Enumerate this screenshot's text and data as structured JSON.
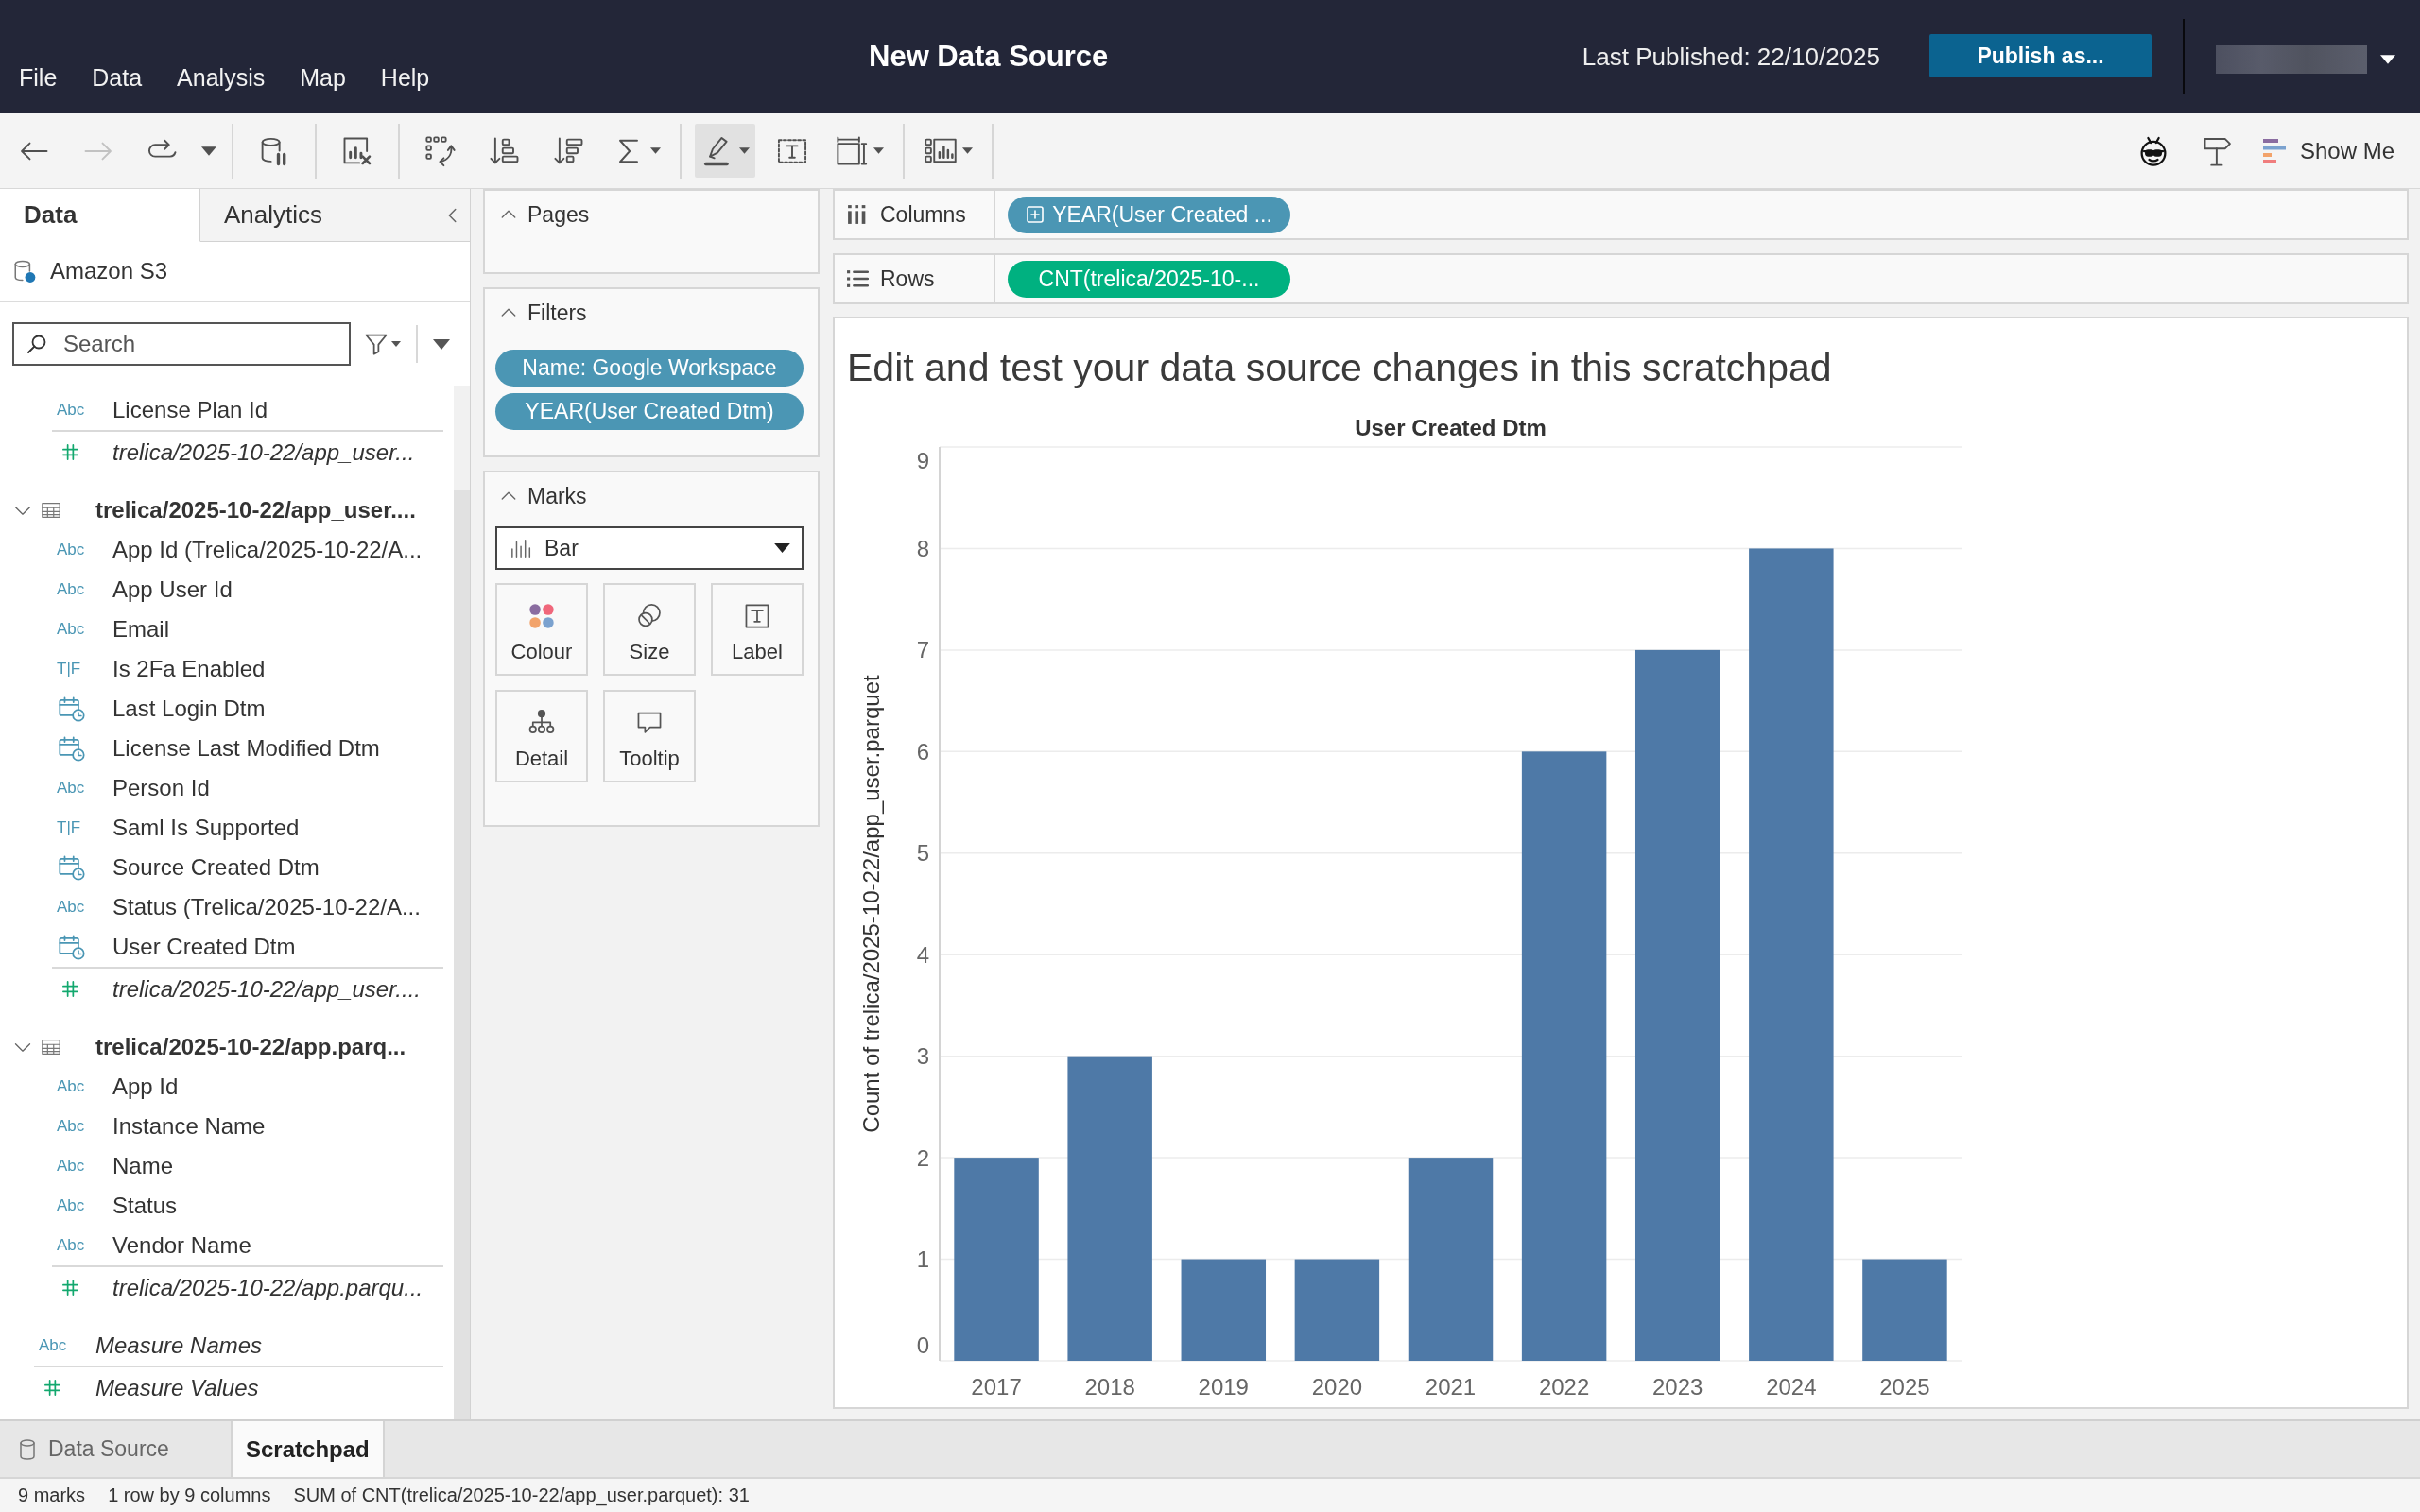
{
  "header": {
    "menu": [
      "File",
      "Data",
      "Analysis",
      "Map",
      "Help"
    ],
    "title": "New Data Source",
    "last_published": "Last Published: 22/10/2025",
    "publish_button": "Publish as..."
  },
  "toolbar": {
    "groups": [
      [
        {
          "kind": "back",
          "disabled": false,
          "pressed": false,
          "menu": false
        },
        {
          "kind": "forward",
          "disabled": true,
          "pressed": false,
          "menu": false
        },
        {
          "kind": "replay",
          "disabled": false,
          "pressed": false,
          "menu": false
        },
        {
          "kind": "dropdown",
          "disabled": false,
          "pressed": false,
          "menu": true
        }
      ],
      [
        {
          "kind": "datasource-pause",
          "disabled": false,
          "pressed": false,
          "menu": false
        }
      ],
      [
        {
          "kind": "clear-sheet",
          "disabled": false,
          "pressed": false,
          "menu": false
        }
      ],
      [
        {
          "kind": "swap",
          "disabled": false,
          "pressed": false,
          "menu": false
        },
        {
          "kind": "sort-ascending",
          "disabled": false,
          "pressed": false,
          "menu": false
        },
        {
          "kind": "sort-descending",
          "disabled": false,
          "pressed": false,
          "menu": false
        },
        {
          "kind": "totals",
          "disabled": false,
          "pressed": false,
          "menu": true
        }
      ],
      [
        {
          "kind": "highlight",
          "disabled": false,
          "pressed": true,
          "menu": true
        },
        {
          "kind": "labels",
          "disabled": false,
          "pressed": false,
          "menu": false
        },
        {
          "kind": "fit",
          "disabled": false,
          "pressed": false,
          "menu": true
        }
      ],
      [
        {
          "kind": "show-cards",
          "disabled": false,
          "pressed": false,
          "menu": true
        }
      ]
    ],
    "right": [
      {
        "kind": "face",
        "disabled": false,
        "pressed": false,
        "menu": false
      },
      {
        "kind": "signpost",
        "disabled": false,
        "pressed": false,
        "menu": false
      }
    ],
    "show_me": "Show Me"
  },
  "data_pane": {
    "tabs": [
      {
        "label": "Data",
        "selected": true
      },
      {
        "label": "Analytics",
        "selected": false
      }
    ],
    "data_source": "Amazon S3",
    "search": {
      "placeholder": "Search"
    },
    "tables": [
      {
        "children": [
          {
            "name": "License Plan Id",
            "kind": "dimension",
            "type_label": "Abc",
            "generated": false
          },
          {
            "name": "trelica/2025-10-22/app_user...",
            "kind": "measure",
            "generated": true
          }
        ]
      },
      {
        "name": "trelica/2025-10-22/app_user....",
        "expanded": true,
        "children": [
          {
            "name": "App Id (Trelica/2025-10-22/A...",
            "kind": "dimension",
            "type_label": "Abc",
            "generated": false
          },
          {
            "name": "App User Id",
            "kind": "dimension",
            "type_label": "Abc",
            "generated": false
          },
          {
            "name": "Email",
            "kind": "dimension",
            "type_label": "Abc",
            "generated": false
          },
          {
            "name": "Is 2Fa Enabled",
            "kind": "boolean",
            "type_label": "T|F",
            "generated": false
          },
          {
            "name": "Last Login Dtm",
            "kind": "date",
            "generated": false
          },
          {
            "name": "License Last Modified Dtm",
            "kind": "date",
            "generated": false
          },
          {
            "name": "Person Id",
            "kind": "dimension",
            "type_label": "Abc",
            "generated": false
          },
          {
            "name": "Saml Is Supported",
            "kind": "boolean",
            "type_label": "T|F",
            "generated": false
          },
          {
            "name": "Source Created Dtm",
            "kind": "date",
            "generated": false
          },
          {
            "name": "Status (Trelica/2025-10-22/A...",
            "kind": "dimension",
            "type_label": "Abc",
            "generated": false
          },
          {
            "name": "User Created Dtm",
            "kind": "date",
            "generated": false
          },
          {
            "name": "trelica/2025-10-22/app_user....",
            "kind": "measure",
            "generated": true
          }
        ]
      },
      {
        "name": "trelica/2025-10-22/app.parq...",
        "expanded": true,
        "children": [
          {
            "name": "App Id",
            "kind": "dimension",
            "type_label": "Abc",
            "generated": false
          },
          {
            "name": "Instance Name",
            "kind": "dimension",
            "type_label": "Abc",
            "generated": false
          },
          {
            "name": "Name",
            "kind": "dimension",
            "type_label": "Abc",
            "generated": false
          },
          {
            "name": "Status",
            "kind": "dimension",
            "type_label": "Abc",
            "generated": false
          },
          {
            "name": "Vendor Name",
            "kind": "dimension",
            "type_label": "Abc",
            "generated": false
          },
          {
            "name": "trelica/2025-10-22/app.parqu...",
            "kind": "measure",
            "generated": true
          }
        ]
      }
    ],
    "fields": [
      {
        "name": "Measure Names",
        "kind": "dimension",
        "type_label": "Abc",
        "generated": true
      },
      {
        "name": "Measure Values",
        "kind": "measure",
        "generated": true
      }
    ]
  },
  "cards": {
    "pages": {
      "title": "Pages",
      "expanded": true
    },
    "filters": {
      "title": "Filters",
      "expanded": true,
      "pills": [
        "Name: Google Workspace",
        "YEAR(User Created Dtm)"
      ]
    },
    "marks": {
      "title": "Marks",
      "expanded": true,
      "mark_type": "Bar",
      "buttons": [
        {
          "label": "Colour",
          "kind": "colour"
        },
        {
          "label": "Size",
          "kind": "size"
        },
        {
          "label": "Label",
          "kind": "label"
        },
        {
          "label": "Detail",
          "kind": "detail"
        },
        {
          "label": "Tooltip",
          "kind": "tooltip"
        }
      ]
    }
  },
  "shelves": [
    {
      "label": "Columns",
      "kind": "columns",
      "pills": [
        {
          "text": "YEAR(User Created ...",
          "kind": "dimension",
          "drillable": true
        }
      ]
    },
    {
      "label": "Rows",
      "kind": "rows",
      "pills": [
        {
          "text": "CNT(trelica/2025-10-...",
          "kind": "measure",
          "drillable": false
        }
      ]
    }
  ],
  "viz": {
    "title": "Edit and test your data source changes in this scratchpad",
    "chart_data": {
      "type": "bar",
      "title": "User Created Dtm",
      "ylabel": "Count of trelica/2025-10-22/app_user.parquet",
      "categories": [
        "2017",
        "2018",
        "2019",
        "2020",
        "2021",
        "2022",
        "2023",
        "2024",
        "2025"
      ],
      "values": [
        2,
        3,
        1,
        1,
        2,
        6,
        7,
        8,
        1
      ],
      "ylim": [
        0,
        9
      ],
      "yticks": [
        0,
        1,
        2,
        3,
        4,
        5,
        6,
        7,
        8,
        9
      ],
      "grid": true
    }
  },
  "sheet_tabs": [
    {
      "label": "Data Source",
      "kind": "data-source",
      "selected": false
    },
    {
      "label": "Scratchpad",
      "kind": "sheet",
      "selected": true
    }
  ],
  "status_bar": [
    "9 marks",
    "1 row by 9 columns",
    "SUM of CNT(trelica/2025-10-22/app_user.parquet): 31"
  ]
}
